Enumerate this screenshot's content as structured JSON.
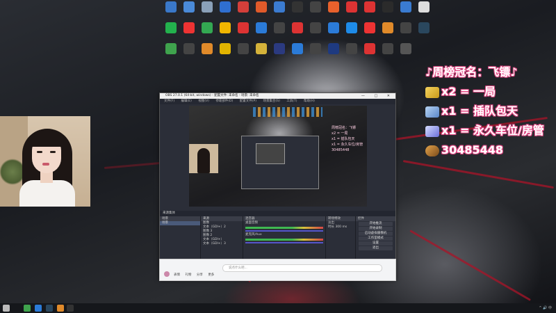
{
  "desktop": {
    "icons": [
      {
        "label": "",
        "icon": "computer-icon",
        "color": "#3a78c9"
      },
      {
        "label": "",
        "icon": "monitor-icon",
        "color": "#4a8ad8"
      },
      {
        "label": "",
        "icon": "recycle-bin-icon",
        "color": "#8aa0b8"
      },
      {
        "label": "",
        "icon": "app-icon",
        "color": "#2f6fd0"
      },
      {
        "label": "",
        "icon": "app-icon",
        "color": "#d43f3a"
      },
      {
        "label": "",
        "icon": "app-icon",
        "color": "#e05a2a"
      },
      {
        "label": "",
        "icon": "app-icon",
        "color": "#3b7bd0"
      },
      {
        "label": "",
        "icon": "app-icon",
        "color": "#333333"
      },
      {
        "label": "",
        "icon": "app-icon",
        "color": "#444444"
      },
      {
        "label": "",
        "icon": "app-icon",
        "color": "#e8612c"
      },
      {
        "label": "",
        "icon": "app-icon",
        "color": "#d33"
      },
      {
        "label": "",
        "icon": "app-icon",
        "color": "#d33"
      },
      {
        "label": "",
        "icon": "app-icon",
        "color": "#2b2b2b"
      },
      {
        "label": "",
        "icon": "app-icon",
        "color": "#3a7bd0"
      },
      {
        "label": "",
        "icon": "file-icon",
        "color": "#dddddd"
      },
      {
        "label": "",
        "icon": "iqiyi-icon",
        "color": "#23b14d"
      },
      {
        "label": "",
        "icon": "app-icon",
        "color": "#e33"
      },
      {
        "label": "",
        "icon": "play-store-icon",
        "color": "#33a852"
      },
      {
        "label": "",
        "icon": "app-icon",
        "color": "#f2b600"
      },
      {
        "label": "",
        "icon": "app-icon",
        "color": "#d33"
      },
      {
        "label": "",
        "icon": "app-icon",
        "color": "#2b7bd8"
      },
      {
        "label": "",
        "icon": "app-icon",
        "color": "#444"
      },
      {
        "label": "",
        "icon": "app-icon",
        "color": "#d33"
      },
      {
        "label": "",
        "icon": "app-icon",
        "color": "#444"
      },
      {
        "label": "",
        "icon": "app-icon",
        "color": "#2b7bd8"
      },
      {
        "label": "",
        "icon": "qq-icon",
        "color": "#1e8be8"
      },
      {
        "label": "",
        "icon": "app-icon",
        "color": "#e33"
      },
      {
        "label": "",
        "icon": "app-icon",
        "color": "#e08a2a"
      },
      {
        "label": "",
        "icon": "app-icon",
        "color": "#444"
      },
      {
        "label": "",
        "icon": "steam-icon",
        "color": "#2a475e"
      },
      {
        "label": "",
        "icon": "app-icon",
        "color": "#3fa34d"
      },
      {
        "label": "",
        "icon": "app-icon",
        "color": "#444"
      },
      {
        "label": "",
        "icon": "app-icon",
        "color": "#e08a2a"
      },
      {
        "label": "",
        "icon": "app-icon",
        "color": "#e2b400"
      },
      {
        "label": "",
        "icon": "app-icon",
        "color": "#444"
      },
      {
        "label": "",
        "icon": "app-icon",
        "color": "#d4b23a"
      },
      {
        "label": "",
        "icon": "app-icon",
        "color": "#2b3a80"
      },
      {
        "label": "",
        "icon": "app-icon",
        "color": "#2b7bd8"
      },
      {
        "label": "",
        "icon": "app-icon",
        "color": "#444"
      },
      {
        "label": "",
        "icon": "app-icon",
        "color": "#1e3a80"
      },
      {
        "label": "",
        "icon": "app-icon",
        "color": "#444"
      },
      {
        "label": "",
        "icon": "app-icon",
        "color": "#d33"
      },
      {
        "label": "",
        "icon": "app-icon",
        "color": "#444"
      },
      {
        "label": "",
        "icon": "app-icon",
        "color": "#555"
      }
    ]
  },
  "overlay": {
    "title": "♪周榜冠名：飞镖♪",
    "lines": [
      {
        "badge": "badge-gold",
        "icon": "gift-gold-icon",
        "text": "x2 = 一局"
      },
      {
        "badge": "badge-ship",
        "icon": "gift-ship-icon",
        "text": "x1 = 插队包天"
      },
      {
        "badge": "badge-rocket",
        "icon": "gift-rocket-icon",
        "text": "x1 = 永久车位/房管"
      },
      {
        "badge": "badge-bear",
        "icon": "bear-icon",
        "text": "30485448"
      }
    ]
  },
  "obs": {
    "title": "OBS 27.0.1 (64-bit, windows) - 配置文件: 未命名 - 场景: 未命名",
    "window_buttons": "— □ ✕",
    "menu": [
      "文件(F)",
      "编辑(E)",
      "视图(V)",
      "停靠部件(D)",
      "配置文件(P)",
      "场景集合(S)",
      "工具(T)",
      "帮助(H)"
    ],
    "preview_overlay_lines": [
      "周榜冠名：飞镖",
      "x2 = 一局",
      "x1 = 插队包天",
      "x1 = 永久车位/房管",
      "30485448"
    ],
    "dock_header": "来源集体",
    "scenes": {
      "header": "场景",
      "items": [
        "场景"
      ]
    },
    "sources": {
      "header": "来源",
      "items": [
        "图像",
        "文本（GDI+）2",
        "图像 3",
        "图像 2",
        "文本（GDI+）",
        "文本（GDI+）3"
      ]
    },
    "mixer": {
      "header": "混音器",
      "channels": [
        "桌面音频",
        "麦克风/Aux"
      ]
    },
    "transitions": {
      "header": "转场特效",
      "type": "淡出",
      "duration_label": "时长",
      "duration": "300 ms"
    },
    "controls": {
      "header": "控件",
      "buttons": [
        "开始推流",
        "开始录制",
        "启动虚拟摄像机",
        "工作室模式",
        "设置",
        "退出"
      ]
    }
  },
  "chat": {
    "placeholder": "说点什么吧...",
    "tools": [
      "表情",
      "礼物",
      "分享",
      "更多"
    ]
  },
  "taskbar": {
    "items": [
      {
        "icon": "start-icon",
        "color": "#bbb"
      },
      {
        "icon": "app-icon",
        "color": "#3fa34d"
      },
      {
        "icon": "app-icon",
        "color": "#2b7bd8"
      },
      {
        "icon": "steam-icon",
        "color": "#2a475e"
      },
      {
        "icon": "app-icon",
        "color": "#e08a2a"
      },
      {
        "icon": "obs-icon",
        "color": "#333"
      }
    ],
    "tray": "^ 🔊 中"
  }
}
